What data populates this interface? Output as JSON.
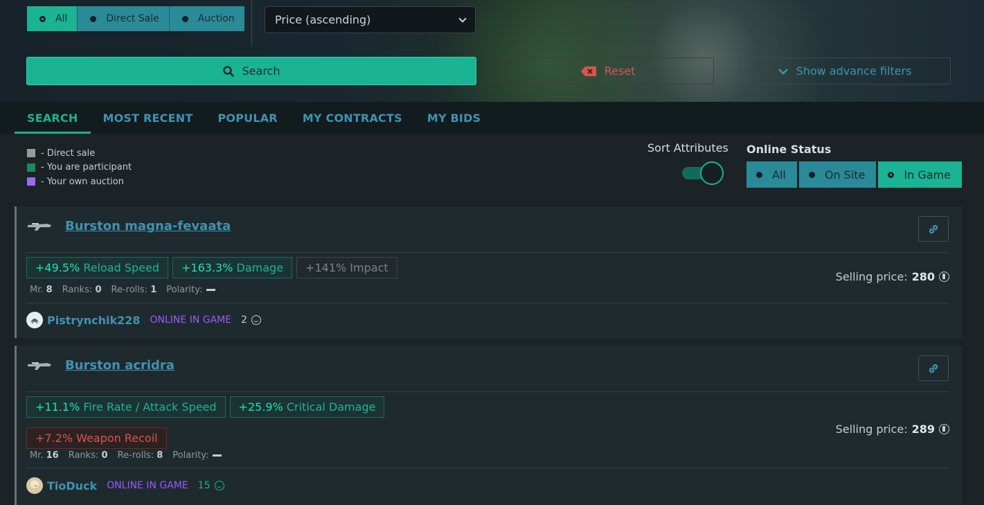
{
  "filters": {
    "sale_type": [
      {
        "label": "All",
        "active": true
      },
      {
        "label": "Direct Sale",
        "active": false
      },
      {
        "label": "Auction",
        "active": false
      }
    ],
    "sort_select": "Price (ascending)",
    "search_label": "Search",
    "reset_label": "Reset",
    "advanced_label": "Show advance filters"
  },
  "tabs": [
    {
      "label": "SEARCH",
      "active": true
    },
    {
      "label": "MOST RECENT",
      "active": false
    },
    {
      "label": "POPULAR",
      "active": false
    },
    {
      "label": "MY CONTRACTS",
      "active": false
    },
    {
      "label": "MY BIDS",
      "active": false
    }
  ],
  "legend": [
    {
      "label": "- Direct sale",
      "color": "#9a9a9a"
    },
    {
      "label": "- You are participant",
      "color": "#1a8a5a"
    },
    {
      "label": "- Your own auction",
      "color": "#9b6bf0"
    }
  ],
  "sort_attributes": {
    "label": "Sort Attributes",
    "enabled": true
  },
  "online_status": {
    "label": "Online Status",
    "options": [
      {
        "label": "All",
        "active": false
      },
      {
        "label": "On Site",
        "active": false
      },
      {
        "label": "In Game",
        "active": true
      }
    ]
  },
  "colors": {
    "accent": "#1ab394",
    "link": "#3f93b0",
    "danger": "#d9534f",
    "status": "#9b59ff"
  },
  "auctions": [
    {
      "name": "Burston magna-fevaata",
      "attributes": [
        {
          "value": "+49.5%",
          "name": "Reload Speed",
          "kind": "pos"
        },
        {
          "value": "+163.3%",
          "name": "Damage",
          "kind": "pos"
        },
        {
          "value": "+141%",
          "name": "Impact",
          "kind": "neu"
        }
      ],
      "mr_label": "Mr.",
      "mr": "8",
      "ranks_label": "Ranks:",
      "ranks": "0",
      "rerolls_label": "Re-rolls:",
      "rerolls": "1",
      "polarity_label": "Polarity:",
      "price_label": "Selling price:",
      "price": "280",
      "user": "Pistrynchik228",
      "status": "ONLINE IN GAME",
      "reputation": "2"
    },
    {
      "name": "Burston acridra",
      "attributes": [
        {
          "value": "+11.1%",
          "name": "Fire Rate / Attack Speed",
          "kind": "pos"
        },
        {
          "value": "+25.9%",
          "name": "Critical Damage",
          "kind": "pos"
        },
        {
          "value": "+7.2%",
          "name": "Weapon Recoil",
          "kind": "neg"
        }
      ],
      "mr_label": "Mr.",
      "mr": "16",
      "ranks_label": "Ranks:",
      "ranks": "0",
      "rerolls_label": "Re-rolls:",
      "rerolls": "8",
      "polarity_label": "Polarity:",
      "price_label": "Selling price:",
      "price": "289",
      "user": "TioDuck",
      "status": "ONLINE IN GAME",
      "reputation": "15"
    }
  ]
}
